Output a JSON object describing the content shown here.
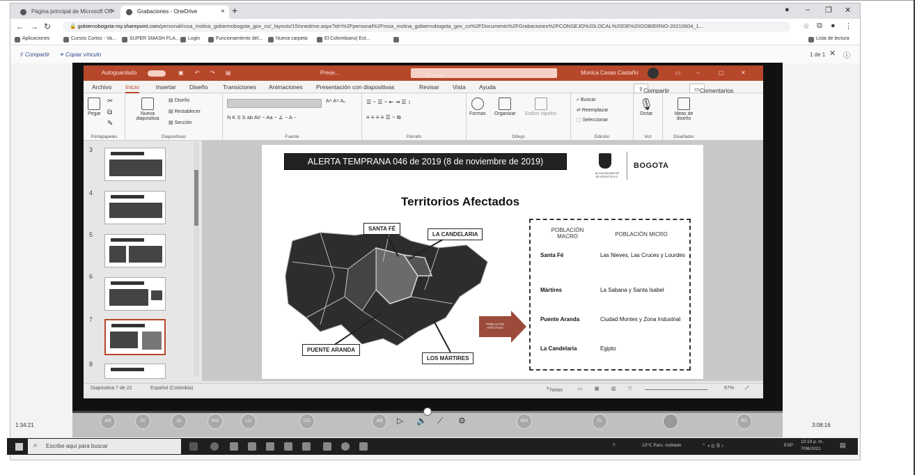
{
  "browser": {
    "tabs": [
      {
        "label": "Página principal de Microsoft Off",
        "active": false
      },
      {
        "label": "Grabaciones - OneDrive",
        "active": true
      }
    ],
    "url_host": "gobiernobogota-my.sharepoint.com",
    "url_path": "/personal/rosa_molina_gobiernobogota_gov_co/_layouts/15/onedrive.aspx?id=%2Fpersonal%2Frosa_molina_gobiernobogota_gov_co%2FDocuments%2FGrabaciones%2FCONSEJO%20LOCAL%20DE%20GOBIERNO-20210604_1...",
    "bookmarks": [
      "Aplicaciones",
      "Cursos Cortos - Va...",
      "SUPER SMASH FLA...",
      "Login",
      "Funcionamiento del...",
      "Nueva carpeta",
      "El Colombiano| Est...",
      "Lista de lectura"
    ]
  },
  "onedrive": {
    "share_label": "Compartir",
    "copy_link_label": "Copiar vínculo",
    "page_count": "1 de 1"
  },
  "powerpoint": {
    "autosave_label": "Autoguardado",
    "file_name": "Prese...",
    "search_placeholder": "Buscar",
    "user_name": "Monica Casas Castaño",
    "menu": [
      "Archivo",
      "Inicio",
      "Insertar",
      "Diseño",
      "Transiciones",
      "Animaciones",
      "Presentación con diapositivas",
      "Revisar",
      "Vista",
      "Ayuda"
    ],
    "share_button": "Compartir",
    "comments_button": "Comentarios",
    "ribbon": {
      "paste": "Pegar",
      "new_slide": "Nueva diapositiva",
      "layout": "Diseño",
      "reset": "Restablecer",
      "section": "Sección",
      "shapes": "Formas",
      "arrange": "Organizar",
      "quick_styles": "Estilos rápidos",
      "find": "Buscar",
      "replace": "Reemplazar",
      "select": "Seleccionar",
      "dictate": "Dictar",
      "design_ideas": "Ideas de diseño",
      "groups": [
        "Portapapeles",
        "Diapositivas",
        "Fuente",
        "Párrafo",
        "Dibujo",
        "Edición",
        "Voz",
        "Diseñador"
      ]
    },
    "thumb_numbers": [
      "3",
      "4",
      "5",
      "6",
      "7",
      "8"
    ],
    "status": {
      "slide_info": "Diapositiva 7 de 22",
      "language": "Español (Colombia)",
      "notes": "Notas",
      "zoom": "67%"
    }
  },
  "slide": {
    "alert_title": "ALERTA TEMPRANA 046 de 2019 (8 de noviembre de 2019)",
    "brand": "BOGOTA",
    "brand_sub": "ALCALDÍA MAYOR DE BOGOTÁ D.C.",
    "title": "Territorios Afectados",
    "callouts": [
      "SANTA FÉ",
      "LA CANDELARIA",
      "PUENTE ARANDA",
      "LOS MÁRTIRES"
    ],
    "arrow_label": "POBLACIÓN AFECTADA",
    "table": {
      "col_macro": "POBLACIÓN MACRO",
      "col_micro": "POBLACIÓN MICRO",
      "rows": [
        {
          "macro": "Santa Fé",
          "micro": "Las Nieves, Las Cruces y Lourdes"
        },
        {
          "macro": "Mártires",
          "micro": "La Sabana y Santa Isabel"
        },
        {
          "macro": "Puente Aranda",
          "micro": "Ciudad Montes y Zona Industrial"
        },
        {
          "macro": "La Candelaria",
          "micro": "Egipto"
        }
      ]
    }
  },
  "player": {
    "elapsed": "1:34:21",
    "duration": "3:08:16",
    "progress": 0.5,
    "participants": [
      "AR",
      "JV",
      "IA",
      "MS",
      "LU",
      "DG",
      "AB",
      "MA",
      "TL",
      "",
      "RC"
    ]
  },
  "taskbar": {
    "search_placeholder": "Escribe aquí para buscar",
    "weather": "13°C Parc. nublado",
    "lang": "ESP",
    "clock": "10:19 p. m.",
    "date": "7/06/2021"
  }
}
